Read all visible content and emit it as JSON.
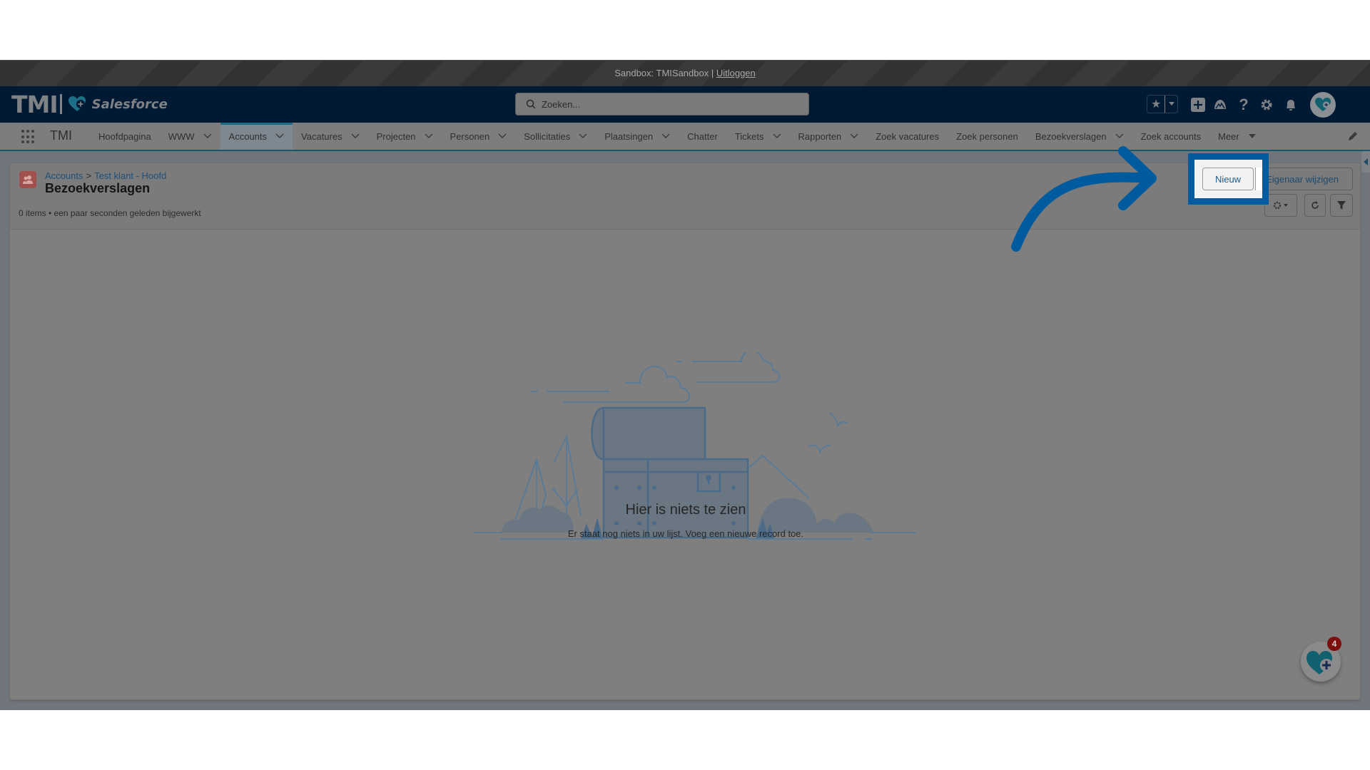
{
  "sandbox_bar": {
    "text": "Sandbox: TMISandbox | ",
    "logout_link": "Uitloggen"
  },
  "header": {
    "logo_text": "TMI",
    "logo_brand": "Salesforce",
    "search_placeholder": "Zoeken...",
    "icons": [
      "star-icon",
      "chevron-down-icon",
      "add-icon",
      "trailhead-icon",
      "help-icon",
      "gear-icon",
      "bell-icon",
      "avatar"
    ]
  },
  "nav": {
    "app_name": "TMI",
    "tabs": [
      {
        "label": "Hoofdpagina",
        "has_menu": false,
        "active": false
      },
      {
        "label": "WWW",
        "has_menu": true,
        "active": false
      },
      {
        "label": "Accounts",
        "has_menu": true,
        "active": true
      },
      {
        "label": "Vacatures",
        "has_menu": true,
        "active": false
      },
      {
        "label": "Projecten",
        "has_menu": true,
        "active": false
      },
      {
        "label": "Personen",
        "has_menu": true,
        "active": false
      },
      {
        "label": "Sollicitaties",
        "has_menu": true,
        "active": false
      },
      {
        "label": "Plaatsingen",
        "has_menu": true,
        "active": false
      },
      {
        "label": "Chatter",
        "has_menu": false,
        "active": false
      },
      {
        "label": "Tickets",
        "has_menu": true,
        "active": false
      },
      {
        "label": "Rapporten",
        "has_menu": true,
        "active": false
      },
      {
        "label": "Zoek vacatures",
        "has_menu": false,
        "active": false
      },
      {
        "label": "Zoek personen",
        "has_menu": false,
        "active": false
      },
      {
        "label": "Bezoekverslagen",
        "has_menu": true,
        "active": false
      },
      {
        "label": "Zoek accounts",
        "has_menu": false,
        "active": false
      },
      {
        "label": "Meer",
        "has_menu": true,
        "active": false
      }
    ]
  },
  "list_view": {
    "breadcrumb": {
      "root": "Accounts",
      "separator": ">",
      "parent": "Test klant - Hoofd"
    },
    "title": "Bezoekverslagen",
    "meta": "0 items • een paar seconden geleden bijgewerkt",
    "buttons": {
      "new": "Nieuw",
      "change_owner": "Eigenaar wijzigen"
    },
    "empty_state": {
      "title": "Hier is niets te zien",
      "subtitle": "Er staat nog niets in uw lijst. Voeg een nieuwe record toe."
    }
  },
  "help_widget": {
    "badge_count": "4"
  },
  "annotation": {
    "highlight_color": "#005a9e",
    "arrow_color": "#005a9e",
    "target": "Nieuw"
  }
}
